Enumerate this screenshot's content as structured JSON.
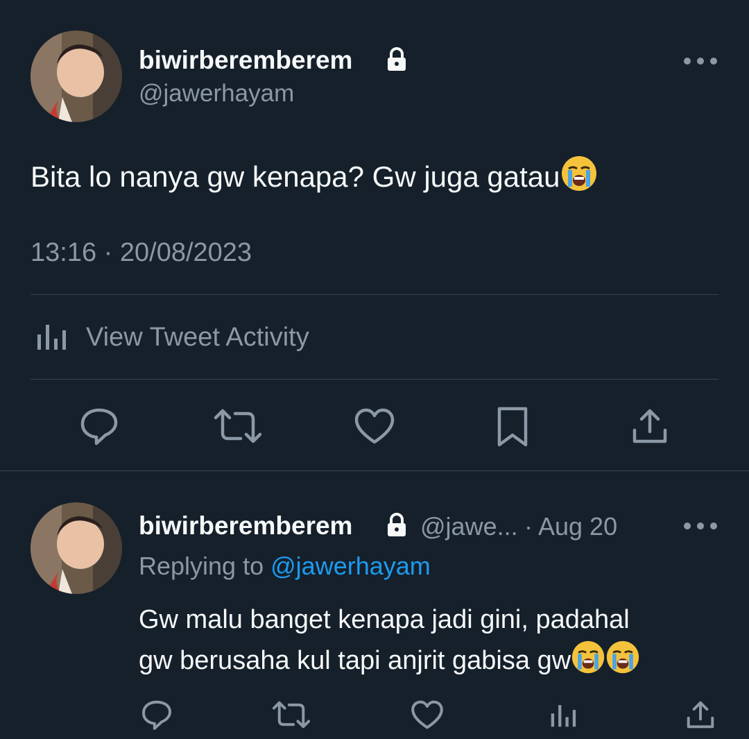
{
  "main_tweet": {
    "display_name": "biwirberemberem",
    "handle": "@jawerhayam",
    "text": "Bita lo nanya gw kenapa? Gw juga gatau",
    "emoji": "crying-face",
    "timestamp": "13:16 · 20/08/2023",
    "activity_label": "View Tweet Activity"
  },
  "reply_tweet": {
    "display_name": "biwirberemberem",
    "handle_short": "@jawe...",
    "date": "· Aug 20",
    "replying_prefix": "Replying to",
    "replying_handle": "@jawerhayam",
    "line1": "Gw malu banget kenapa jadi gini, padahal",
    "line2": "gw berusaha kul tapi anjrit gabisa gw",
    "emojis": [
      "crying-face",
      "crying-face"
    ]
  },
  "colors": {
    "background": "#15202b",
    "text": "#f7f9f9",
    "secondary": "#8b98a5",
    "link": "#1d9bf0",
    "divider": "#38444d"
  }
}
